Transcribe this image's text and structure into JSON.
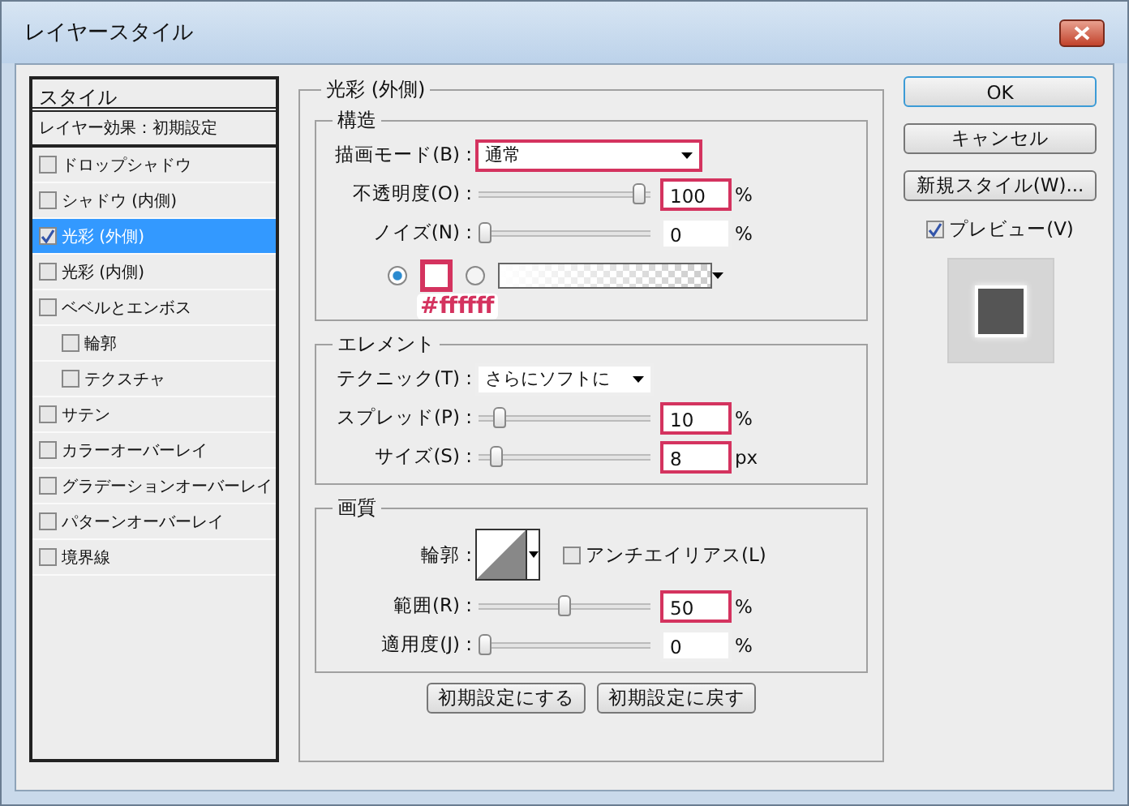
{
  "window": {
    "title": "レイヤースタイル"
  },
  "sidebar": {
    "header": "スタイル",
    "blending": "レイヤー効果：初期設定",
    "items": [
      {
        "label": "ドロップシャドウ",
        "checked": false,
        "selected": false
      },
      {
        "label": "シャドウ (内側)",
        "checked": false,
        "selected": false
      },
      {
        "label": "光彩 (外側)",
        "checked": true,
        "selected": true
      },
      {
        "label": "光彩 (内側)",
        "checked": false,
        "selected": false
      },
      {
        "label": "ベベルとエンボス",
        "checked": false,
        "selected": false,
        "children": [
          {
            "label": "輪郭",
            "checked": false,
            "selected": false
          },
          {
            "label": "テクスチャ",
            "checked": false,
            "selected": false
          }
        ]
      },
      {
        "label": "サテン",
        "checked": false,
        "selected": false
      },
      {
        "label": "カラーオーバーレイ",
        "checked": false,
        "selected": false
      },
      {
        "label": "グラデーションオーバーレイ",
        "checked": false,
        "selected": false
      },
      {
        "label": "パターンオーバーレイ",
        "checked": false,
        "selected": false
      },
      {
        "label": "境界線",
        "checked": false,
        "selected": false
      }
    ]
  },
  "panel": {
    "title": "光彩 (外側)",
    "structure": {
      "title": "構造",
      "blend_mode": {
        "label": "描画モード(B) :",
        "value": "通常",
        "highlighted": true
      },
      "sliders": [
        {
          "label": "不透明度(O) :",
          "level": 0.97,
          "value": "100",
          "unit": "%",
          "highlighted": true
        },
        {
          "label": "ノイズ(N) :",
          "level": 0,
          "value": "0",
          "unit": "%",
          "highlighted": false
        }
      ],
      "fill": [
        {
          "kind": "color",
          "selected": true,
          "highlighted": true
        },
        {
          "kind": "gradient",
          "selected": false,
          "highlighted": false
        }
      ],
      "annotation": "#ffffff"
    },
    "elements": {
      "title": "エレメント",
      "technique": {
        "label": "テクニック(T) :",
        "value": "さらにソフトに"
      },
      "sliders": [
        {
          "label": "スプレッド(P) :",
          "level": 0.09,
          "value": "10",
          "unit": "%",
          "highlighted": true
        },
        {
          "label": "サイズ(S) :",
          "level": 0.07,
          "value": "8",
          "unit": "px",
          "highlighted": true
        }
      ]
    },
    "quality": {
      "title": "画質",
      "contour": {
        "label": "輪郭 :"
      },
      "anti_alias": {
        "label": "アンチエイリアス(L)",
        "checked": false
      },
      "sliders": [
        {
          "label": "範囲(R) :",
          "level": 0.5,
          "value": "50",
          "unit": "%",
          "highlighted": true
        },
        {
          "label": "適用度(J) :",
          "level": 0,
          "value": "0",
          "unit": "%",
          "highlighted": false
        }
      ]
    },
    "buttons": [
      "初期設定にする",
      "初期設定に戻す"
    ]
  },
  "actions": [
    {
      "label": "OK",
      "default": true
    },
    {
      "label": "キャンセル",
      "default": false
    },
    {
      "label": "新規スタイル(W)...",
      "default": false
    }
  ],
  "preview": {
    "label": "プレビュー(V)",
    "checked": true
  }
}
